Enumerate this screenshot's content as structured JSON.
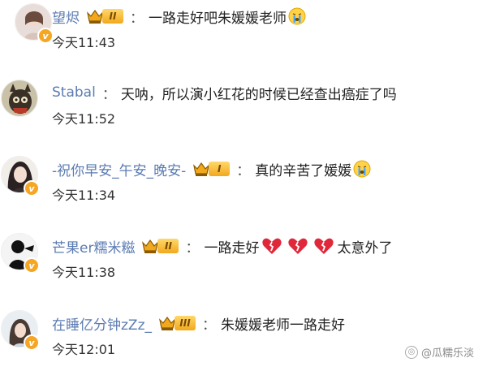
{
  "comments": [
    {
      "username": "望烬",
      "level": "II",
      "text": "一路走好吧朱媛媛老师",
      "time": "今天11:43",
      "verified": true
    },
    {
      "username": "Stabal",
      "text": "天呐，所以演小红花的时候已经查出癌症了吗",
      "time": "今天11:52",
      "verified": false
    },
    {
      "username": "-祝你早安_午安_晚安-",
      "level": "I",
      "text": "真的辛苦了媛媛",
      "time": "今天11:34",
      "verified": true
    },
    {
      "username": "芒果er糯米糍",
      "level": "II",
      "text_before": "一路走好",
      "text_after": "太意外了",
      "time": "今天11:38",
      "verified": true
    },
    {
      "username": "在睡亿分钟zZz_",
      "level": "III",
      "text": "朱媛媛老师一路走好",
      "time": "今天12:01",
      "verified": true
    }
  ],
  "colon": "：",
  "verified_mark": "v",
  "watermark": "@瓜糯乐淡",
  "colors": {
    "username": "#5b7bb2",
    "badge": "#f5a623",
    "heart": "#e0283a"
  }
}
